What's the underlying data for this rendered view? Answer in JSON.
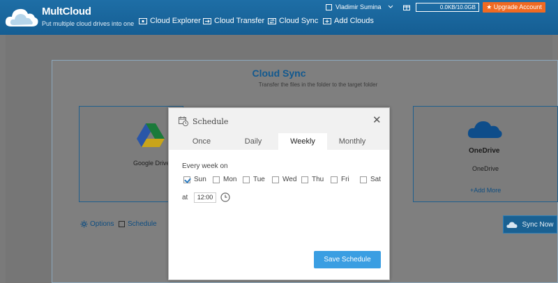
{
  "header": {
    "brand": "MultCloud",
    "tagline": "Put multiple cloud drives into one",
    "nav": [
      {
        "label": "Cloud Explorer",
        "icon": "explorer-icon"
      },
      {
        "label": "Cloud Transfer",
        "icon": "transfer-icon"
      },
      {
        "label": "Cloud Sync",
        "icon": "sync-icon"
      },
      {
        "label": "Add Clouds",
        "icon": "add-icon"
      }
    ],
    "user_name": "Vladimir Sumina",
    "quota": "0.0KB/10.0GB",
    "upgrade_label": "★ Upgrade Account"
  },
  "sync_page": {
    "title": "Cloud Sync",
    "subtitle": "Transfer the files in the folder to the target folder",
    "source_label": "Google Drive",
    "target_name": "OneDrive",
    "target_sub": "OneDrive",
    "add_more": "+Add More",
    "options_label": "Options",
    "schedule_label": "Schedule",
    "sync_now_label": "Sync Now"
  },
  "modal": {
    "title": "Schedule",
    "close_glyph": "✕",
    "tabs": [
      "Once",
      "Daily",
      "Weekly",
      "Monthly"
    ],
    "active_tab": "Weekly",
    "every_label": "Every week on",
    "days": [
      {
        "label": "Sun",
        "checked": true
      },
      {
        "label": "Mon",
        "checked": false
      },
      {
        "label": "Tue",
        "checked": false
      },
      {
        "label": "Wed",
        "checked": false
      },
      {
        "label": "Thu",
        "checked": false
      },
      {
        "label": "Fri",
        "checked": false
      },
      {
        "label": "Sat",
        "checked": false
      }
    ],
    "at_label": "at",
    "time_value": "12:00",
    "save_label": "Save Schedule"
  },
  "colors": {
    "header": "#1a6aa2",
    "accent": "#3a9ee2",
    "upgrade": "#f06a22",
    "title": "#12598f"
  }
}
